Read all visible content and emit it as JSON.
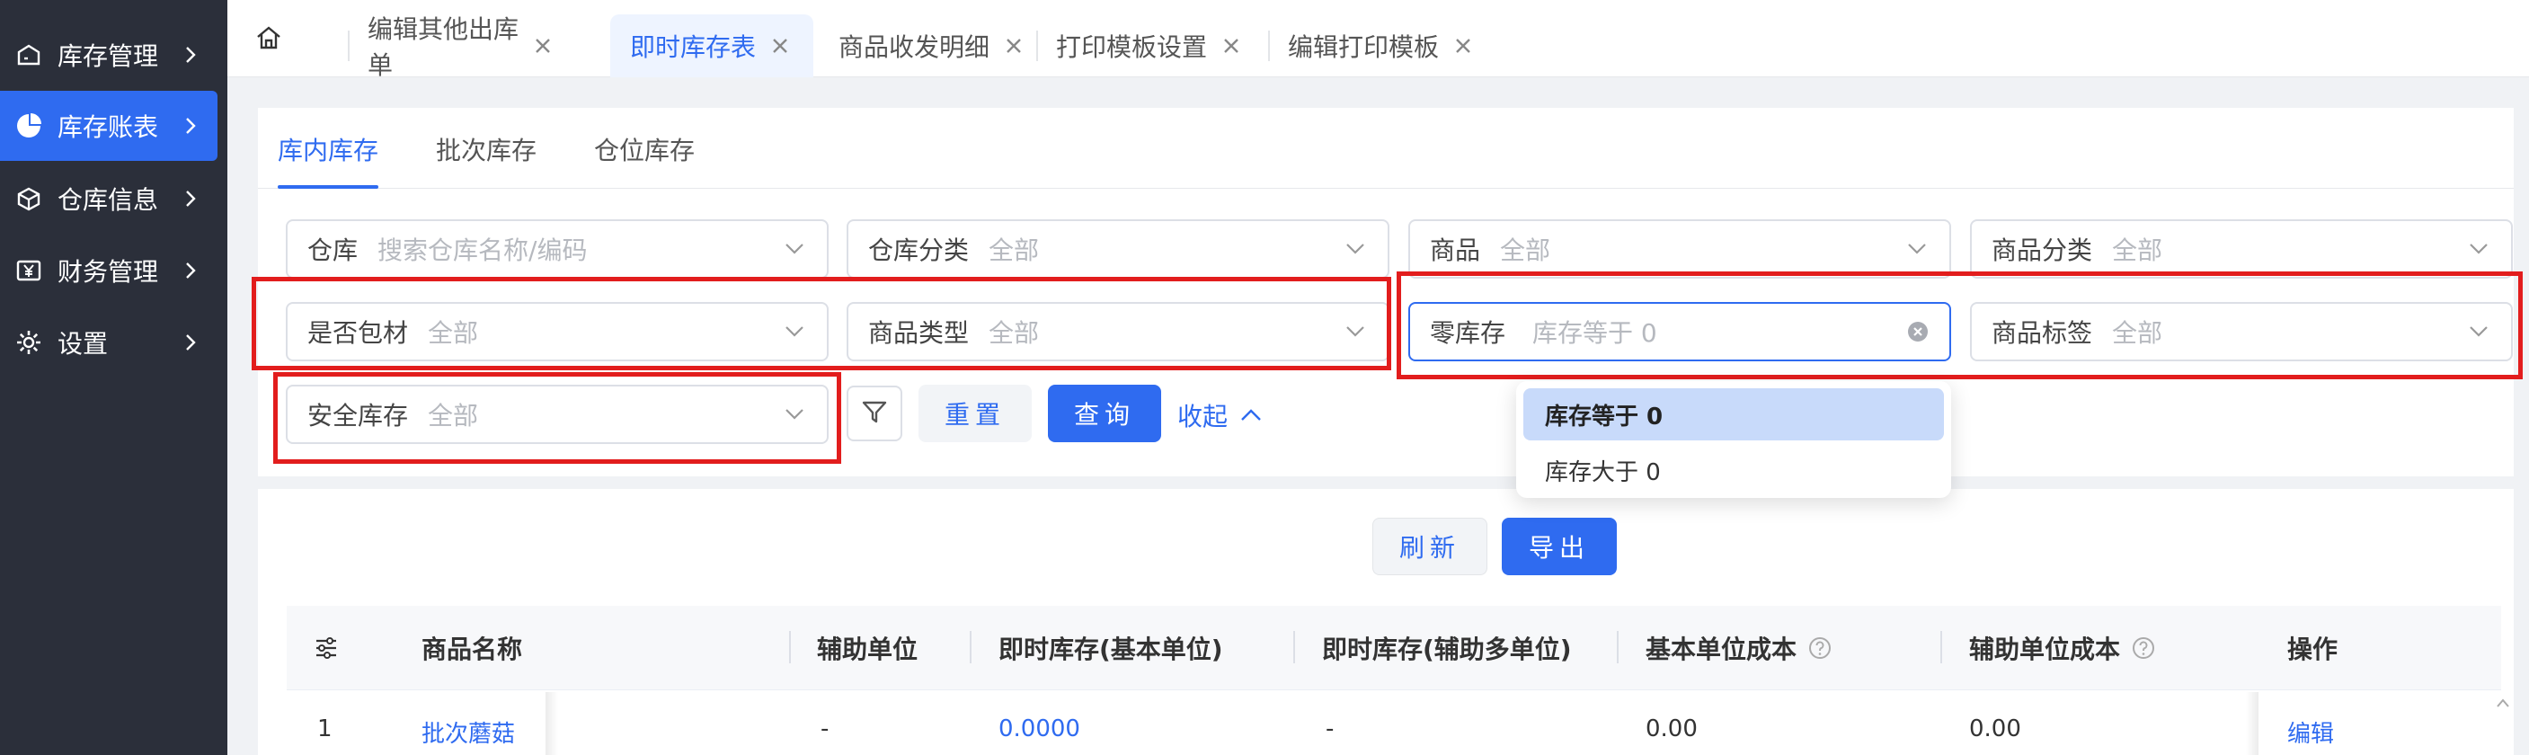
{
  "sidebar": {
    "items": [
      {
        "label": "库存管理",
        "icon": "warehouse-icon"
      },
      {
        "label": "库存账表",
        "icon": "pie-chart-icon",
        "active": true
      },
      {
        "label": "仓库信息",
        "icon": "box-icon"
      },
      {
        "label": "财务管理",
        "icon": "yen-icon"
      },
      {
        "label": "设置",
        "icon": "gear-icon"
      }
    ]
  },
  "tabs": [
    {
      "label": "编辑其他出库单"
    },
    {
      "label": "即时库存表",
      "active": true
    },
    {
      "label": "商品收发明细"
    },
    {
      "label": "打印模板设置"
    },
    {
      "label": "编辑打印模板"
    }
  ],
  "subtabs": [
    {
      "label": "库内库存",
      "active": true
    },
    {
      "label": "批次库存"
    },
    {
      "label": "仓位库存"
    }
  ],
  "filters": {
    "warehouse": {
      "label": "仓库",
      "placeholder": "搜索仓库名称/编码"
    },
    "warehouse_category": {
      "label": "仓库分类",
      "placeholder": "全部"
    },
    "product": {
      "label": "商品",
      "placeholder": "全部"
    },
    "product_category": {
      "label": "商品分类",
      "placeholder": "全部"
    },
    "is_packaging": {
      "label": "是否包材",
      "placeholder": "全部"
    },
    "product_type": {
      "label": "商品类型",
      "placeholder": "全部"
    },
    "zero_stock": {
      "label": "零库存",
      "placeholder": "库存等于 0"
    },
    "product_tag": {
      "label": "商品标签",
      "placeholder": "全部"
    },
    "safety_stock": {
      "label": "安全库存",
      "placeholder": "全部"
    }
  },
  "actions": {
    "reset": "重置",
    "query": "查询",
    "collapse": "收起",
    "refresh": "刷新",
    "export": "导出"
  },
  "dropdown": {
    "options": [
      {
        "label": "库存等于 0",
        "selected": true
      },
      {
        "label": "库存大于 0"
      }
    ]
  },
  "table": {
    "columns": [
      "商品名称",
      "辅助单位",
      "即时库存(基本单位)",
      "即时库存(辅助多单位)",
      "基本单位成本",
      "辅助单位成本",
      "操作"
    ],
    "rows": [
      {
        "index": "1",
        "name": "批次蘑菇",
        "aux_unit": "-",
        "stock_base": "0.0000",
        "stock_aux": "-",
        "cost_base": "0.00",
        "cost_aux": "0.00",
        "action": "编辑"
      }
    ]
  },
  "colors": {
    "accent": "#2f6bf0",
    "sidebar_bg": "#2b2f3a",
    "highlight_red": "#e21d1d"
  }
}
